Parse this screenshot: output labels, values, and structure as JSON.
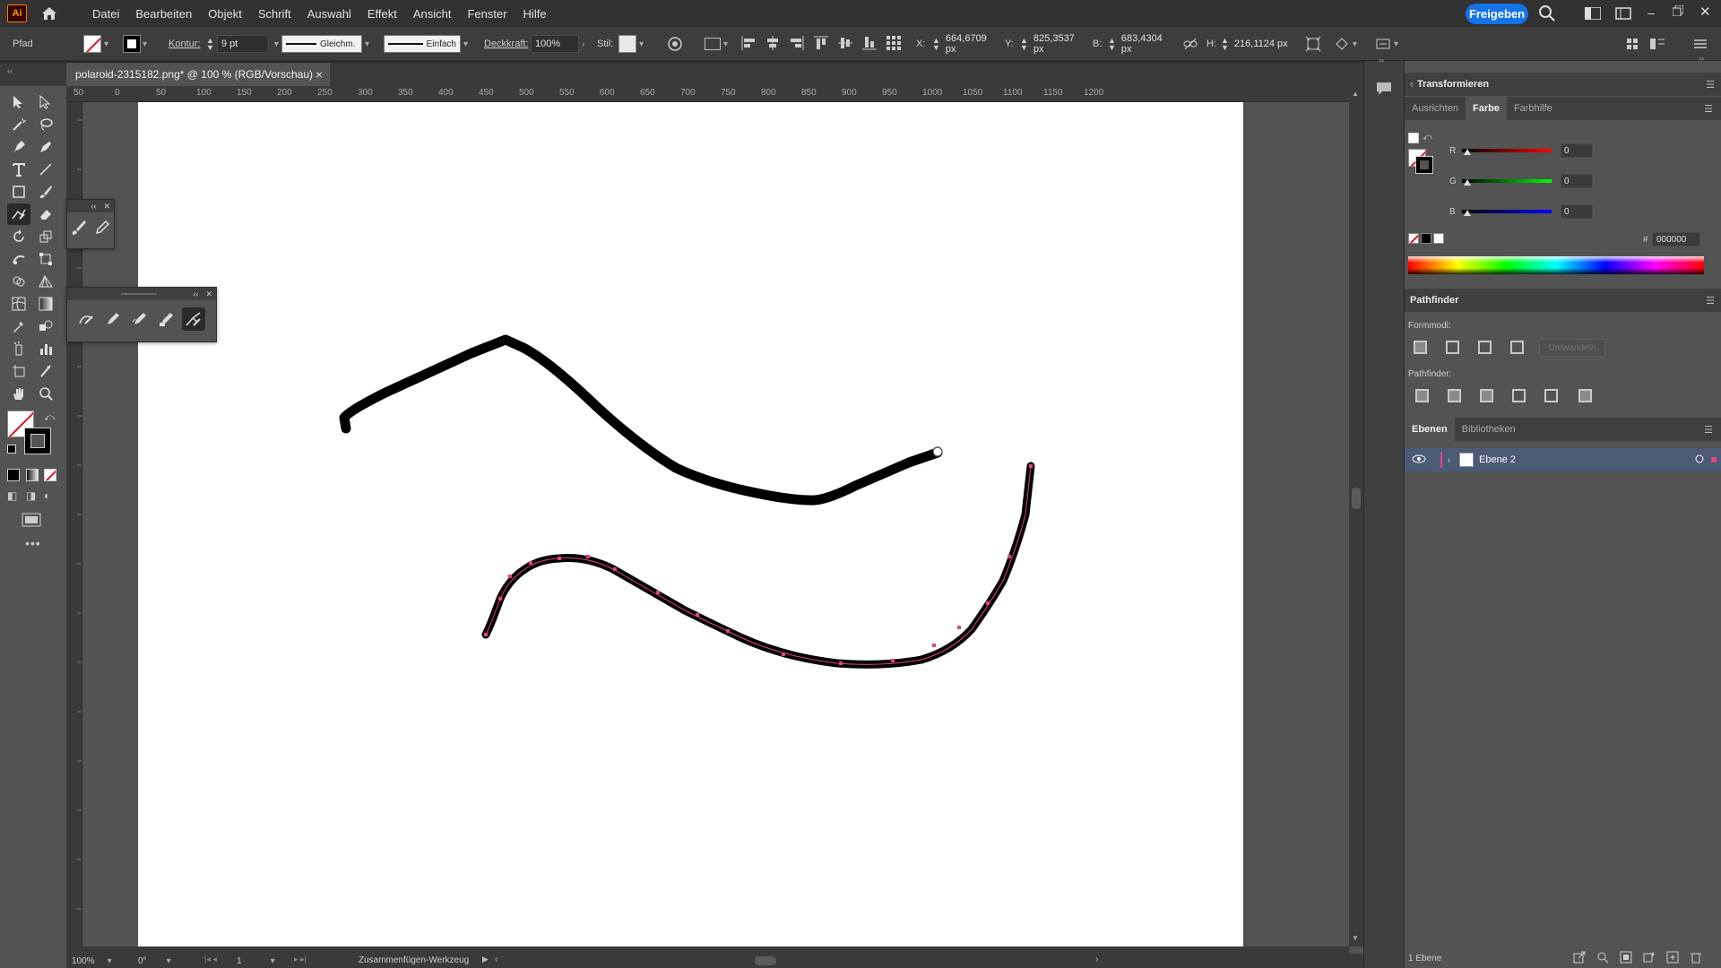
{
  "app": {
    "logo": "Ai",
    "menu": [
      "Datei",
      "Bearbeiten",
      "Objekt",
      "Schrift",
      "Auswahl",
      "Effekt",
      "Ansicht",
      "Fenster",
      "Hilfe"
    ],
    "share_label": "Freigeben"
  },
  "control": {
    "object_type": "Pfad",
    "stroke_label": "Kontur:",
    "stroke_weight": "9 pt",
    "stroke_profile": "Gleichm.",
    "brush": "Einfach",
    "opacity_label": "Deckkraft:",
    "opacity_value": "100%",
    "style_label": "Stil:",
    "x_label": "X:",
    "x_value": "664,6709 px",
    "y_label": "Y:",
    "y_value": "825,3537 px",
    "w_label": "B:",
    "w_value": "683,4304 px",
    "h_label": "H:",
    "h_value": "216,1124 px"
  },
  "document": {
    "tab_title": "polaroid-2315182.png* @ 100 % (RGB/Vorschau)",
    "close": "×"
  },
  "ruler": {
    "h_labels": [
      "50",
      "0",
      "50",
      "100",
      "150",
      "200",
      "250",
      "300",
      "350",
      "400",
      "450",
      "500",
      "550",
      "600",
      "650",
      "700",
      "750",
      "800",
      "850",
      "900",
      "950",
      "1000",
      "1050",
      "1100",
      "1150",
      "1200"
    ]
  },
  "status": {
    "zoom": "100%",
    "rotation": "0°",
    "artboard_num": "1",
    "tool_name": "Zusammenfügen-Werkzeug"
  },
  "panels": {
    "transform_title": "Transformieren",
    "tabs": [
      "Ausrichten",
      "Farbe",
      "Farbhilfe"
    ],
    "active_tab": "Farbe",
    "color": {
      "r_label": "R",
      "r_value": "0",
      "g_label": "G",
      "g_value": "0",
      "b_label": "B",
      "b_value": "0",
      "hex_label": "#",
      "hex_value": "000000"
    },
    "pathfinder": {
      "title": "Pathfinder",
      "shape_modes_label": "Formmodi:",
      "expand_label": "Umwandeln",
      "pathfinder_label": "Pathfinder:"
    },
    "layers": {
      "tabs": [
        "Ebenen",
        "Bibliotheken"
      ],
      "layer_name": "Ebene 2",
      "footer_count": "1 Ebene"
    }
  },
  "colors": {
    "accent": "#1473e6",
    "selection": "#e0457a",
    "stroke": "#000000"
  }
}
